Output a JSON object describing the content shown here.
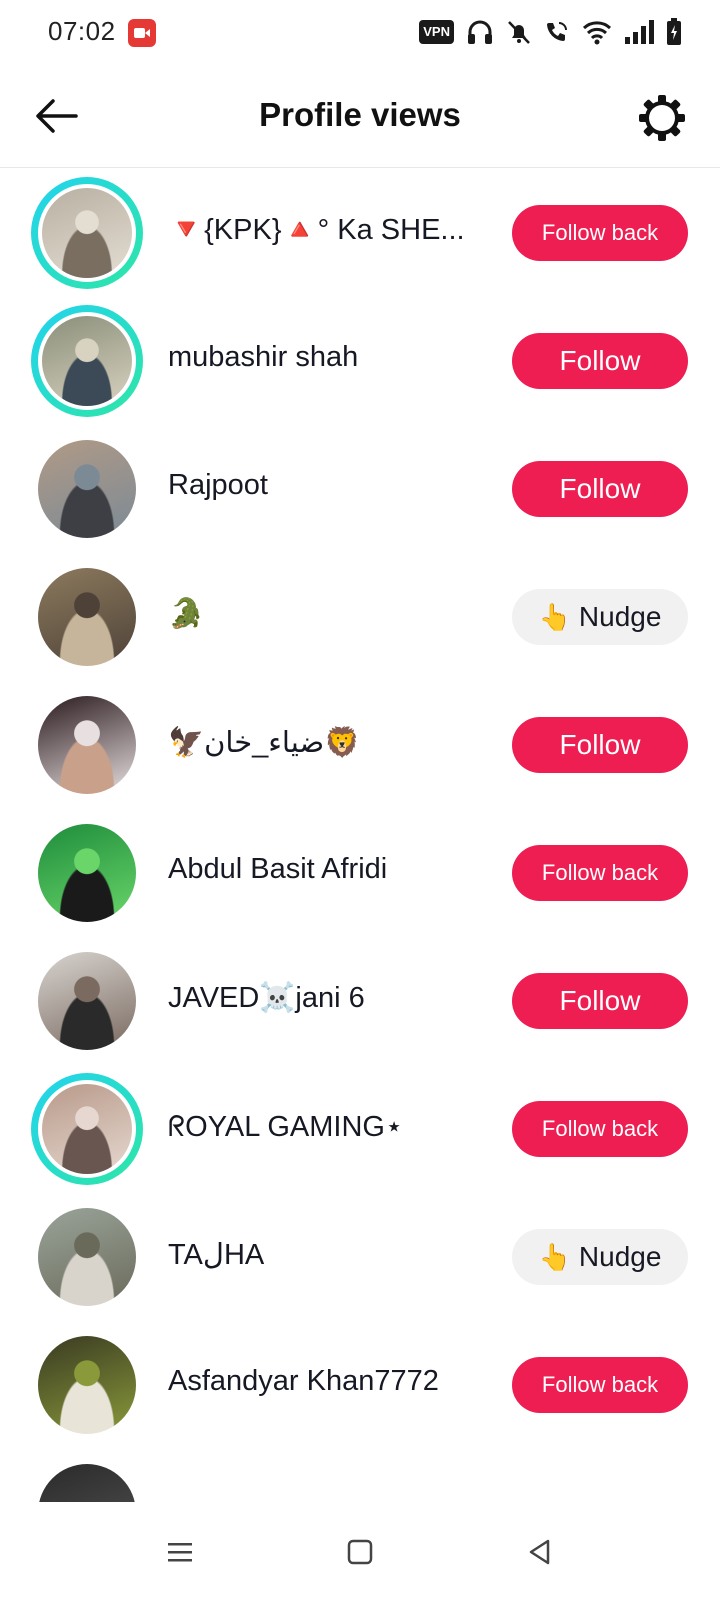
{
  "status_bar": {
    "time": "07:02",
    "vpn_label": "VPN",
    "icons": [
      "screen-record-icon",
      "headphones-icon",
      "bell-muted-icon",
      "wifi-calling-icon",
      "wifi-icon",
      "signal-icon",
      "battery-charging-icon"
    ]
  },
  "header": {
    "title": "Profile views",
    "back_icon": "arrow-left-icon",
    "settings_icon": "gear-icon"
  },
  "viewers": [
    {
      "name": "🔻{KPK}🔺° Ka SHE...",
      "action": "Follow back",
      "action_type": "primary",
      "story_ring": true,
      "avatar_colors": [
        "#b8b0a2",
        "#7a6e60",
        "#e4ddd2"
      ]
    },
    {
      "name": "mubashir shah",
      "action": "Follow",
      "action_type": "primary",
      "story_ring": true,
      "avatar_colors": [
        "#8a8f7a",
        "#3c4a58",
        "#d8d2c0"
      ]
    },
    {
      "name": "Rajpoot",
      "action": "Follow",
      "action_type": "primary",
      "story_ring": false,
      "avatar_colors": [
        "#b09a86",
        "#3d3f44",
        "#7c8a96"
      ]
    },
    {
      "name": "🐊",
      "action": "Nudge",
      "action_type": "secondary",
      "story_ring": false,
      "avatar_colors": [
        "#8c7a5e",
        "#c6b59a",
        "#4e4238"
      ]
    },
    {
      "name": "🦅ضياء_خان🦁",
      "action": "Follow",
      "action_type": "primary",
      "story_ring": false,
      "avatar_colors": [
        "#2a1a1e",
        "#c9a08a",
        "#e8e0e0"
      ]
    },
    {
      "name": "Abdul Basit Afridi",
      "action": "Follow back",
      "action_type": "primary",
      "story_ring": false,
      "avatar_colors": [
        "#1e8c3c",
        "#1a1a1a",
        "#6ad66a"
      ]
    },
    {
      "name": "JAVED☠️jani 6",
      "action": "Follow",
      "action_type": "primary",
      "story_ring": false,
      "avatar_colors": [
        "#d8d4d0",
        "#2a2a2a",
        "#7a6a60"
      ]
    },
    {
      "name": "ᖇOYAL GAMING⋆",
      "action": "Follow back",
      "action_type": "primary",
      "story_ring": true,
      "avatar_colors": [
        "#b89a8a",
        "#6a5650",
        "#e6d8d0"
      ]
    },
    {
      "name": "TAلHA",
      "action": "Nudge",
      "action_type": "secondary",
      "story_ring": false,
      "avatar_colors": [
        "#9aa49a",
        "#d8d4cc",
        "#6a6a5a"
      ]
    },
    {
      "name": "Asfandyar Khan7772",
      "action": "Follow back",
      "action_type": "primary",
      "story_ring": false,
      "avatar_colors": [
        "#3a3a22",
        "#e8e4d8",
        "#8a9a3a"
      ]
    }
  ],
  "nudge_icon": "👆",
  "nav_bar": {
    "icons": [
      "menu-icon",
      "home-square-icon",
      "back-triangle-icon"
    ]
  },
  "colors": {
    "accent": "#ee1d52",
    "secondary_button": "#f1f1f2",
    "story_ring": "#22d3ee"
  }
}
